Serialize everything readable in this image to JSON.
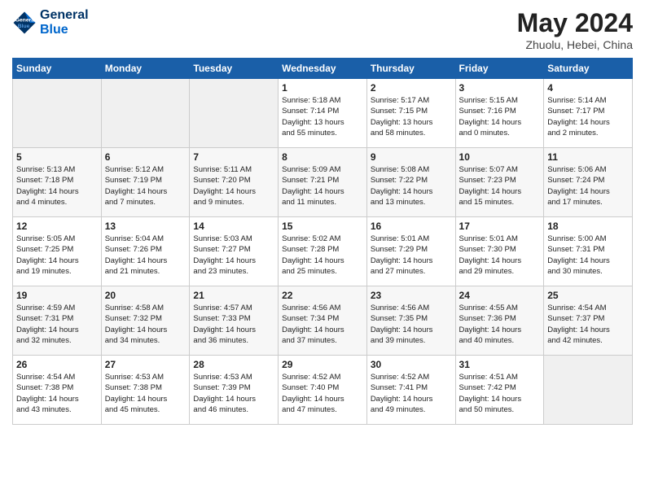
{
  "header": {
    "logo_line1": "General",
    "logo_line2": "Blue",
    "month": "May 2024",
    "location": "Zhuolu, Hebei, China"
  },
  "days_of_week": [
    "Sunday",
    "Monday",
    "Tuesday",
    "Wednesday",
    "Thursday",
    "Friday",
    "Saturday"
  ],
  "weeks": [
    [
      {
        "day": "",
        "info": ""
      },
      {
        "day": "",
        "info": ""
      },
      {
        "day": "",
        "info": ""
      },
      {
        "day": "1",
        "info": "Sunrise: 5:18 AM\nSunset: 7:14 PM\nDaylight: 13 hours\nand 55 minutes."
      },
      {
        "day": "2",
        "info": "Sunrise: 5:17 AM\nSunset: 7:15 PM\nDaylight: 13 hours\nand 58 minutes."
      },
      {
        "day": "3",
        "info": "Sunrise: 5:15 AM\nSunset: 7:16 PM\nDaylight: 14 hours\nand 0 minutes."
      },
      {
        "day": "4",
        "info": "Sunrise: 5:14 AM\nSunset: 7:17 PM\nDaylight: 14 hours\nand 2 minutes."
      }
    ],
    [
      {
        "day": "5",
        "info": "Sunrise: 5:13 AM\nSunset: 7:18 PM\nDaylight: 14 hours\nand 4 minutes."
      },
      {
        "day": "6",
        "info": "Sunrise: 5:12 AM\nSunset: 7:19 PM\nDaylight: 14 hours\nand 7 minutes."
      },
      {
        "day": "7",
        "info": "Sunrise: 5:11 AM\nSunset: 7:20 PM\nDaylight: 14 hours\nand 9 minutes."
      },
      {
        "day": "8",
        "info": "Sunrise: 5:09 AM\nSunset: 7:21 PM\nDaylight: 14 hours\nand 11 minutes."
      },
      {
        "day": "9",
        "info": "Sunrise: 5:08 AM\nSunset: 7:22 PM\nDaylight: 14 hours\nand 13 minutes."
      },
      {
        "day": "10",
        "info": "Sunrise: 5:07 AM\nSunset: 7:23 PM\nDaylight: 14 hours\nand 15 minutes."
      },
      {
        "day": "11",
        "info": "Sunrise: 5:06 AM\nSunset: 7:24 PM\nDaylight: 14 hours\nand 17 minutes."
      }
    ],
    [
      {
        "day": "12",
        "info": "Sunrise: 5:05 AM\nSunset: 7:25 PM\nDaylight: 14 hours\nand 19 minutes."
      },
      {
        "day": "13",
        "info": "Sunrise: 5:04 AM\nSunset: 7:26 PM\nDaylight: 14 hours\nand 21 minutes."
      },
      {
        "day": "14",
        "info": "Sunrise: 5:03 AM\nSunset: 7:27 PM\nDaylight: 14 hours\nand 23 minutes."
      },
      {
        "day": "15",
        "info": "Sunrise: 5:02 AM\nSunset: 7:28 PM\nDaylight: 14 hours\nand 25 minutes."
      },
      {
        "day": "16",
        "info": "Sunrise: 5:01 AM\nSunset: 7:29 PM\nDaylight: 14 hours\nand 27 minutes."
      },
      {
        "day": "17",
        "info": "Sunrise: 5:01 AM\nSunset: 7:30 PM\nDaylight: 14 hours\nand 29 minutes."
      },
      {
        "day": "18",
        "info": "Sunrise: 5:00 AM\nSunset: 7:31 PM\nDaylight: 14 hours\nand 30 minutes."
      }
    ],
    [
      {
        "day": "19",
        "info": "Sunrise: 4:59 AM\nSunset: 7:31 PM\nDaylight: 14 hours\nand 32 minutes."
      },
      {
        "day": "20",
        "info": "Sunrise: 4:58 AM\nSunset: 7:32 PM\nDaylight: 14 hours\nand 34 minutes."
      },
      {
        "day": "21",
        "info": "Sunrise: 4:57 AM\nSunset: 7:33 PM\nDaylight: 14 hours\nand 36 minutes."
      },
      {
        "day": "22",
        "info": "Sunrise: 4:56 AM\nSunset: 7:34 PM\nDaylight: 14 hours\nand 37 minutes."
      },
      {
        "day": "23",
        "info": "Sunrise: 4:56 AM\nSunset: 7:35 PM\nDaylight: 14 hours\nand 39 minutes."
      },
      {
        "day": "24",
        "info": "Sunrise: 4:55 AM\nSunset: 7:36 PM\nDaylight: 14 hours\nand 40 minutes."
      },
      {
        "day": "25",
        "info": "Sunrise: 4:54 AM\nSunset: 7:37 PM\nDaylight: 14 hours\nand 42 minutes."
      }
    ],
    [
      {
        "day": "26",
        "info": "Sunrise: 4:54 AM\nSunset: 7:38 PM\nDaylight: 14 hours\nand 43 minutes."
      },
      {
        "day": "27",
        "info": "Sunrise: 4:53 AM\nSunset: 7:38 PM\nDaylight: 14 hours\nand 45 minutes."
      },
      {
        "day": "28",
        "info": "Sunrise: 4:53 AM\nSunset: 7:39 PM\nDaylight: 14 hours\nand 46 minutes."
      },
      {
        "day": "29",
        "info": "Sunrise: 4:52 AM\nSunset: 7:40 PM\nDaylight: 14 hours\nand 47 minutes."
      },
      {
        "day": "30",
        "info": "Sunrise: 4:52 AM\nSunset: 7:41 PM\nDaylight: 14 hours\nand 49 minutes."
      },
      {
        "day": "31",
        "info": "Sunrise: 4:51 AM\nSunset: 7:42 PM\nDaylight: 14 hours\nand 50 minutes."
      },
      {
        "day": "",
        "info": ""
      }
    ]
  ]
}
